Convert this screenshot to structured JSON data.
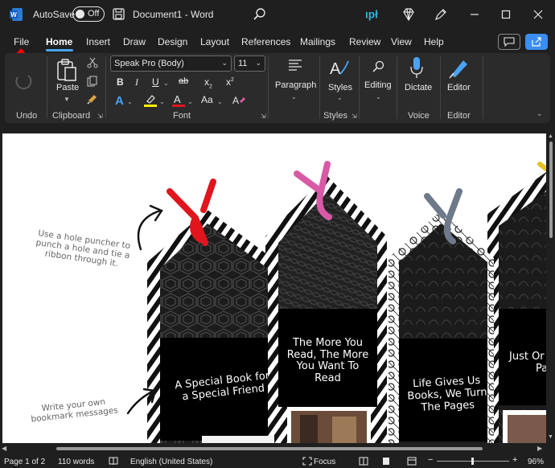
{
  "titlebar": {
    "autosave_label": "AutoSave",
    "autosave_state": "Off",
    "document_title": "Document1  -  Word"
  },
  "tabs": [
    "File",
    "Home",
    "Insert",
    "Draw",
    "Design",
    "Layout",
    "References",
    "Mailings",
    "Review",
    "View",
    "Help"
  ],
  "active_tab": "Home",
  "ribbon": {
    "undo_label": "Undo",
    "clipboard_label": "Clipboard",
    "paste_label": "Paste",
    "font_label": "Font",
    "font_name": "Speak Pro (Body)",
    "font_size": "11",
    "paragraph_label": "Paragraph",
    "styles_label": "Styles",
    "styles_group_label": "Styles",
    "editing_label": "Editing",
    "dictate_label": "Dictate",
    "voice_label": "Voice",
    "editor_label": "Editor",
    "editor_group_label": "Editor",
    "bold": "B",
    "italic": "I",
    "underline": "U",
    "strike": "ab",
    "subscript": "x",
    "superscript": "x",
    "font_color_letter": "A",
    "text_effects_letter": "A",
    "change_case": "Aa"
  },
  "document": {
    "hole_note": [
      "Use a hole puncher to",
      "punch a hole and tie a",
      "ribbon through it."
    ],
    "write_note": [
      "Write your own",
      "bookmark messages"
    ],
    "bookmark1": [
      "A Special Book for",
      "a Special Friend"
    ],
    "bookmark2": [
      "The More You",
      "Read, The More",
      "You Want To",
      "Read"
    ],
    "bookmark3": [
      "Life Gives Us",
      "Books, We Turn",
      "The Pages"
    ],
    "bookmark4": [
      "Just Or",
      "Pa"
    ]
  },
  "statusbar": {
    "page": "Page 1 of 2",
    "words": "110 words",
    "language": "English (United States)",
    "focus": "Focus",
    "zoom": "96%"
  },
  "colors": {
    "accent": "#4aa4f5",
    "arrow": "#ff0000",
    "ribbon_red": "#e0151d",
    "ribbon_pink": "#d85aa6",
    "ribbon_gray": "#6e7a8a"
  }
}
